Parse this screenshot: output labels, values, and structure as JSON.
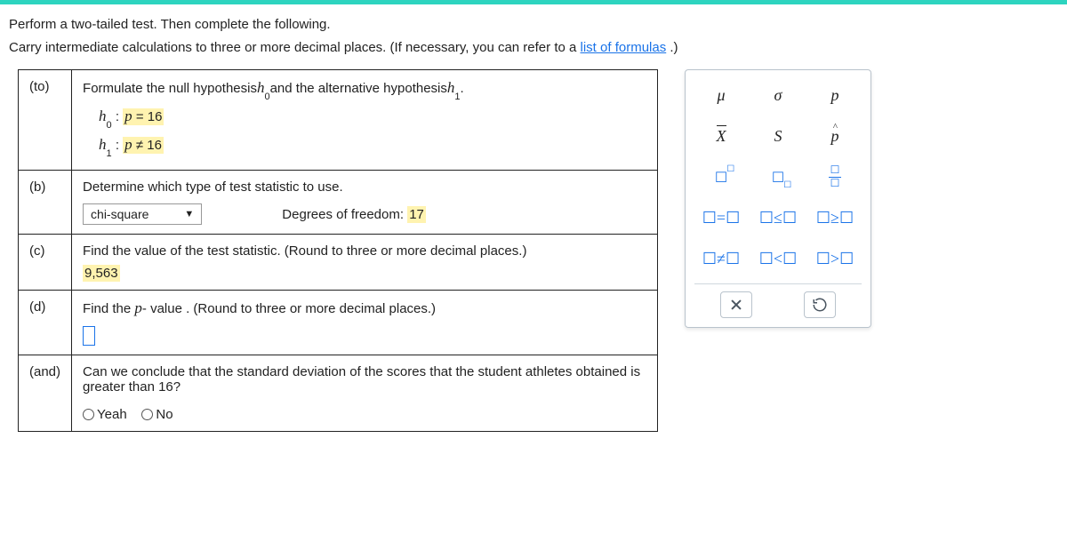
{
  "intro": {
    "line1": "Perform a two-tailed test. Then complete the following.",
    "line2_a": "Carry intermediate calculations to three or more decimal places. (If necessary, you can refer to a ",
    "line2_link": "list of formulas",
    "line2_b": " .)"
  },
  "parts": {
    "a": {
      "label": "(to)",
      "text_a": "Formulate the null hypothesis",
      "text_b": "and the alternative hypothesis",
      "h0_var": "h",
      "h0_sub": "0",
      "h0_colon": " : ",
      "h0_p": "p",
      "h0_rest": " = 16",
      "h1_var": "h",
      "h1_sub": "1",
      "h1_colon": " : ",
      "h1_p": "p",
      "h1_rest": " ≠ 16"
    },
    "b": {
      "label": "(b)",
      "text": "Determine which type of test statistic to use.",
      "select_value": "chi-square",
      "dof_label": "Degrees of freedom: ",
      "dof_value": "17"
    },
    "c": {
      "label": "(c)",
      "text": "Find the value of the test statistic. (Round to three or more decimal places.)",
      "answer": "9,563"
    },
    "d": {
      "label": "(d)",
      "text_a": "Find the ",
      "text_p": "p",
      "text_b": "- value . (Round to three or more decimal places.)"
    },
    "e": {
      "label": "(and)",
      "text": "Can we conclude that the standard deviation of the scores that the student athletes obtained is greater than 16?",
      "opt_yes": "Yeah",
      "opt_no": "No"
    }
  },
  "palette": {
    "r1": [
      "μ",
      "σ",
      "p"
    ],
    "r2_xbar": "X",
    "r2_s": "S",
    "r2_phat": "p",
    "r4": [
      "☐=☐",
      "☐≤☐",
      "☐≥☐"
    ],
    "r5": [
      "☐≠☐",
      "☐<☐",
      "☐>☐"
    ]
  }
}
